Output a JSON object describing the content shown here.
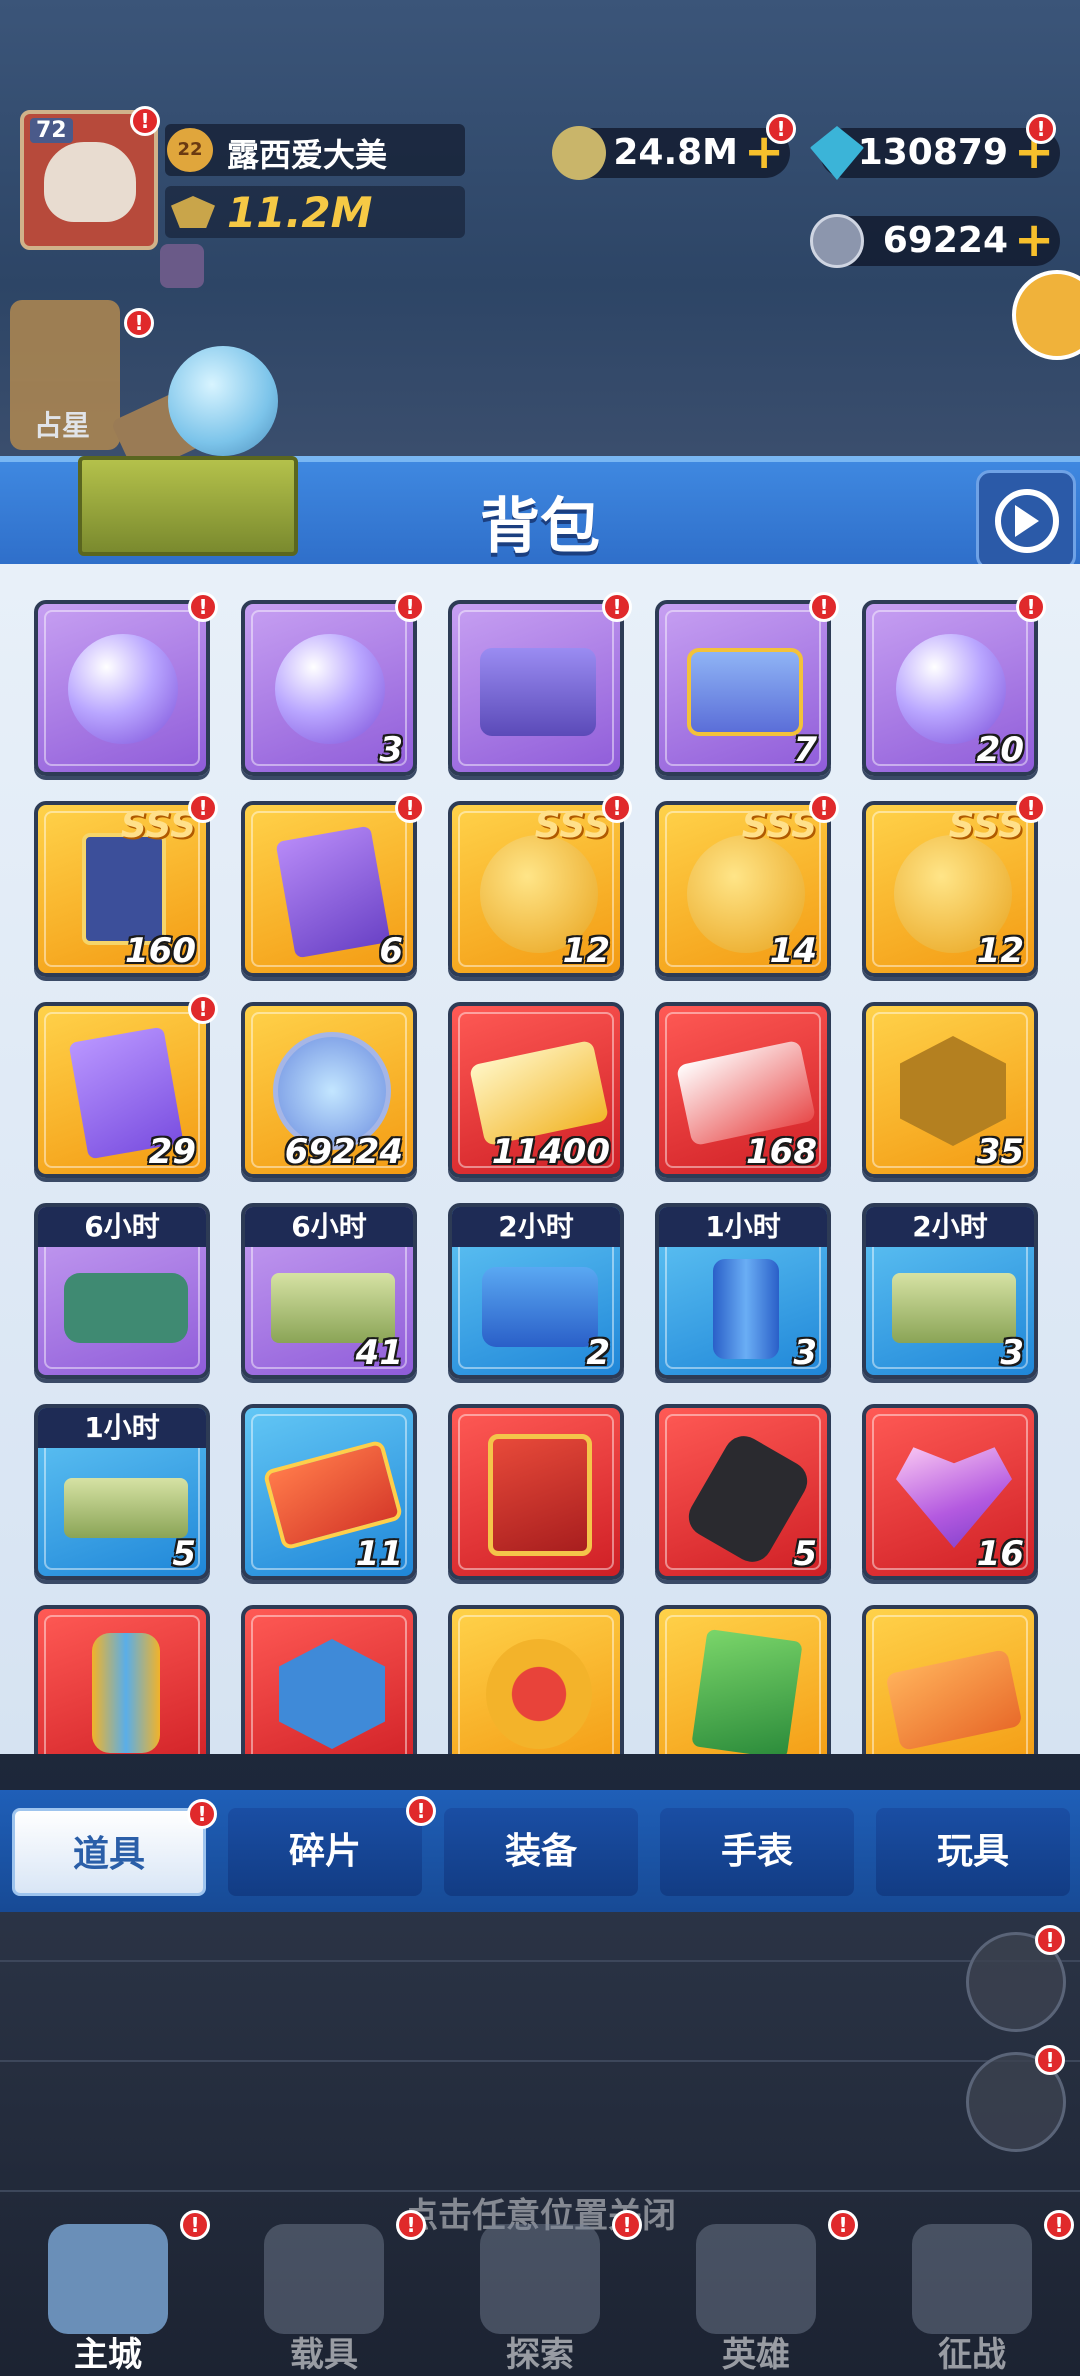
{
  "player": {
    "level": "72",
    "rank": "22",
    "name": "露西爱大美",
    "power": "11.2M",
    "hero_label": "占星"
  },
  "currency": {
    "cash": "24.8M",
    "gems": "130879",
    "coins": "69224"
  },
  "panel": {
    "title": "背包"
  },
  "items": [
    {
      "color": "purple",
      "count": "",
      "timer": "",
      "sss": false,
      "alert": true,
      "icon": "crystal-orb-icon"
    },
    {
      "color": "purple",
      "count": "3",
      "timer": "",
      "sss": false,
      "alert": true,
      "icon": "crystal-orb-icon"
    },
    {
      "color": "purple",
      "count": "",
      "timer": "",
      "sss": false,
      "alert": true,
      "icon": "purple-chest-icon"
    },
    {
      "color": "purple",
      "count": "7",
      "timer": "",
      "sss": false,
      "alert": true,
      "icon": "gold-chest-icon"
    },
    {
      "color": "purple",
      "count": "20",
      "timer": "",
      "sss": false,
      "alert": true,
      "icon": "crystal-orb-icon"
    },
    {
      "color": "gold",
      "count": "160",
      "timer": "",
      "sss": true,
      "alert": true,
      "icon": "hero-card-icon"
    },
    {
      "color": "gold",
      "count": "6",
      "timer": "",
      "sss": false,
      "alert": true,
      "icon": "purple-card-icon"
    },
    {
      "color": "gold",
      "count": "12",
      "timer": "",
      "sss": true,
      "alert": true,
      "icon": "smiley-coin-icon"
    },
    {
      "color": "gold",
      "count": "14",
      "timer": "",
      "sss": true,
      "alert": true,
      "icon": "smiley-coin-icon"
    },
    {
      "color": "gold",
      "count": "12",
      "timer": "",
      "sss": true,
      "alert": true,
      "icon": "smiley-coin-icon"
    },
    {
      "color": "gold",
      "count": "29",
      "timer": "",
      "sss": false,
      "alert": true,
      "icon": "mystery-card-icon"
    },
    {
      "color": "gold",
      "count": "69224",
      "timer": "",
      "sss": false,
      "alert": false,
      "icon": "b-coin-icon"
    },
    {
      "color": "red",
      "count": "11400",
      "timer": "",
      "sss": false,
      "alert": false,
      "icon": "gold-card-icon"
    },
    {
      "color": "red",
      "count": "168",
      "timer": "",
      "sss": false,
      "alert": false,
      "icon": "red-card-icon"
    },
    {
      "color": "gold",
      "count": "35",
      "timer": "",
      "sss": false,
      "alert": false,
      "icon": "building-badge-icon"
    },
    {
      "color": "purple",
      "count": "",
      "timer": "6小时",
      "sss": false,
      "alert": false,
      "icon": "exp-bag-icon"
    },
    {
      "color": "purple",
      "count": "41",
      "timer": "6小时",
      "sss": false,
      "alert": false,
      "icon": "cash-stack-icon"
    },
    {
      "color": "blue",
      "count": "2",
      "timer": "2小时",
      "sss": false,
      "alert": false,
      "icon": "exp-cans-icon"
    },
    {
      "color": "blue",
      "count": "3",
      "timer": "1小时",
      "sss": false,
      "alert": false,
      "icon": "exp-can-icon"
    },
    {
      "color": "blue",
      "count": "3",
      "timer": "2小时",
      "sss": false,
      "alert": false,
      "icon": "cash-stack-icon"
    },
    {
      "color": "blue",
      "count": "5",
      "timer": "1小时",
      "sss": false,
      "alert": false,
      "icon": "cash-icon"
    },
    {
      "color": "blue",
      "count": "11",
      "timer": "",
      "sss": false,
      "alert": false,
      "icon": "red-ticket-icon"
    },
    {
      "color": "red",
      "count": "",
      "timer": "",
      "sss": false,
      "alert": false,
      "icon": "red-book-icon"
    },
    {
      "color": "red",
      "count": "5",
      "timer": "",
      "sss": false,
      "alert": false,
      "icon": "fabric-roll-icon"
    },
    {
      "color": "red",
      "count": "16",
      "timer": "",
      "sss": false,
      "alert": false,
      "icon": "heart-gem-icon"
    },
    {
      "color": "red",
      "count": "",
      "timer": "",
      "sss": false,
      "alert": false,
      "icon": "spray-can-icon"
    },
    {
      "color": "red",
      "count": "",
      "timer": "",
      "sss": false,
      "alert": false,
      "icon": "medal-2-icon"
    },
    {
      "color": "gold",
      "count": "",
      "timer": "",
      "sss": false,
      "alert": false,
      "icon": "star-badge-icon"
    },
    {
      "color": "gold",
      "count": "",
      "timer": "",
      "sss": false,
      "alert": false,
      "icon": "green-card-icon"
    },
    {
      "color": "gold",
      "count": "",
      "timer": "",
      "sss": false,
      "alert": false,
      "icon": "ticket-icon"
    }
  ],
  "tabs": [
    {
      "label": "道具",
      "active": true,
      "alert": true
    },
    {
      "label": "碎片",
      "active": false,
      "alert": true
    },
    {
      "label": "装备",
      "active": false,
      "alert": false
    },
    {
      "label": "手表",
      "active": false,
      "alert": false
    },
    {
      "label": "玩具",
      "active": false,
      "alert": false
    }
  ],
  "close_hint": "点击任意位置关闭",
  "nav": [
    {
      "label": "主城",
      "active": true,
      "alert": true
    },
    {
      "label": "载具",
      "active": false,
      "alert": true
    },
    {
      "label": "探索",
      "active": false,
      "alert": true
    },
    {
      "label": "英雄",
      "active": false,
      "alert": true
    },
    {
      "label": "征战",
      "active": false,
      "alert": true
    }
  ],
  "colors": {
    "purple": "#a676e6",
    "gold": "#f8b62a",
    "red": "#e8363a",
    "blue": "#3aa8ec",
    "accent": "#2f6fca"
  }
}
